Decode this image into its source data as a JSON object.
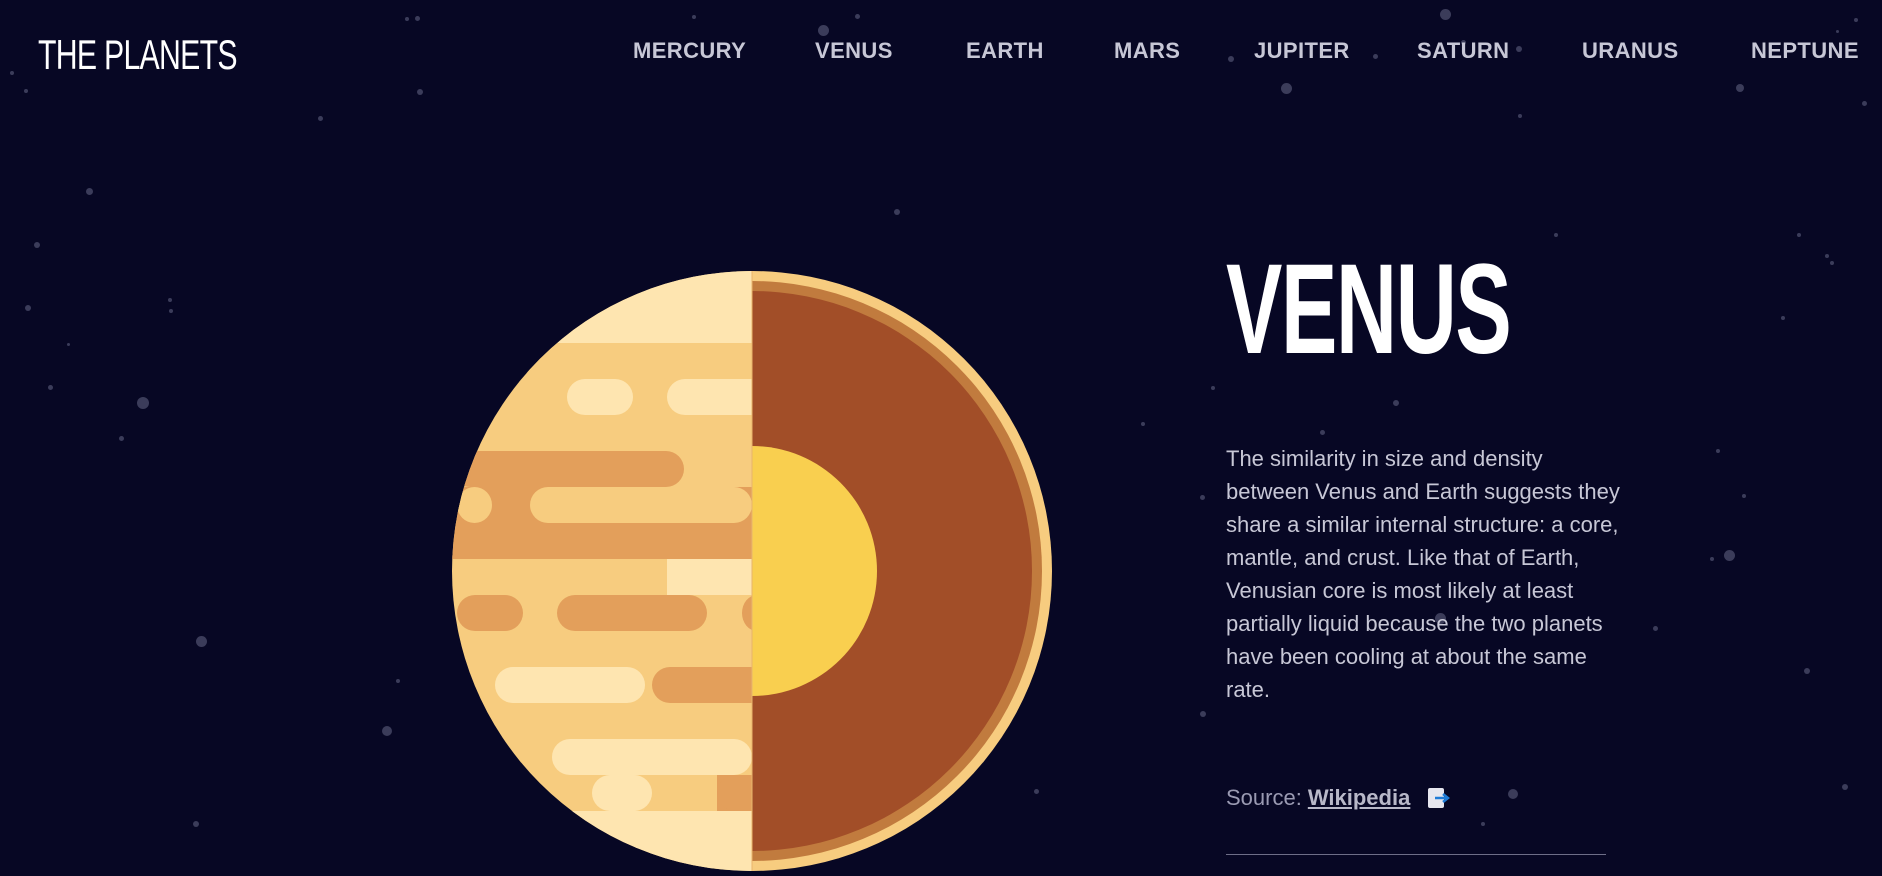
{
  "header": {
    "logo": "THE PLANETS"
  },
  "nav": {
    "items": [
      {
        "label": "MERCURY"
      },
      {
        "label": "VENUS"
      },
      {
        "label": "EARTH"
      },
      {
        "label": "MARS"
      },
      {
        "label": "JUPITER"
      },
      {
        "label": "SATURN"
      },
      {
        "label": "URANUS"
      },
      {
        "label": "NEPTUNE"
      }
    ]
  },
  "planet": {
    "name": "VENUS",
    "description": "The similarity in size and density between Venus and Earth suggests they share a similar internal structure: a core, mantle, and crust. Like that of Earth, Venusian core is most likely at least partially liquid because the two planets have been cooling at about the same rate.",
    "source_label": "Source:",
    "source_link": "Wikipedia"
  },
  "colors": {
    "background": "#070724",
    "text": "#ffffff",
    "nav_text": "#c7c7d6",
    "venus_light": "#fee5b0",
    "venus_mid": "#f7cc7f",
    "venus_band": "#e39f5b",
    "mantle": "#a24e28",
    "crust": "#c17b3e",
    "core": "#f9cf4f",
    "source_icon": "#1e7bd6"
  },
  "icons": {
    "source": "external-link-icon"
  }
}
